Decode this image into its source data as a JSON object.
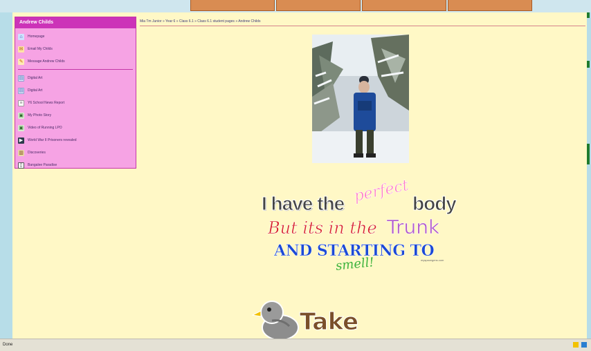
{
  "sidebar": {
    "title": "Andrew Childs",
    "items": [
      {
        "label": "Homepage",
        "icon": "home-icon"
      },
      {
        "label": "Email My Childs",
        "icon": "mail-icon"
      },
      {
        "label": "Message Andrew Childs",
        "icon": "message-icon"
      },
      {
        "label": "Digital Art",
        "icon": "document-icon"
      },
      {
        "label": "Digital Art",
        "icon": "document-icon"
      },
      {
        "label": "Y6 School News Report",
        "icon": "news-icon"
      },
      {
        "label": "My Photo Story",
        "icon": "picture-icon"
      },
      {
        "label": "Video of Running LPO",
        "icon": "picture-icon"
      },
      {
        "label": "World War II Prisoners revealed",
        "icon": "film-icon"
      },
      {
        "label": "Discoveries",
        "icon": "book-icon"
      },
      {
        "label": "Bangalee Paradise",
        "icon": "file-icon"
      }
    ]
  },
  "breadcrumb": "Mia Tm Junior » Year 6 » Class 6.1 » Class 6.1 student pages » Andrew Childs",
  "graphic_text": {
    "line1": "I have the",
    "perfect": "perfect",
    "body": "body",
    "line2": "But its in the",
    "trunk": "Trunk",
    "line3": "AND STARTING TO",
    "smell": "smell!",
    "site": "myspacegens.com"
  },
  "revenge": "Take Revenge",
  "status": {
    "text": "Done"
  },
  "colors": {
    "page_bg": "#fff8c6",
    "sidebar_bg": "#f6a3e4",
    "sidebar_title_bg": "#cc33b8",
    "window_bg": "#b7dde8"
  }
}
